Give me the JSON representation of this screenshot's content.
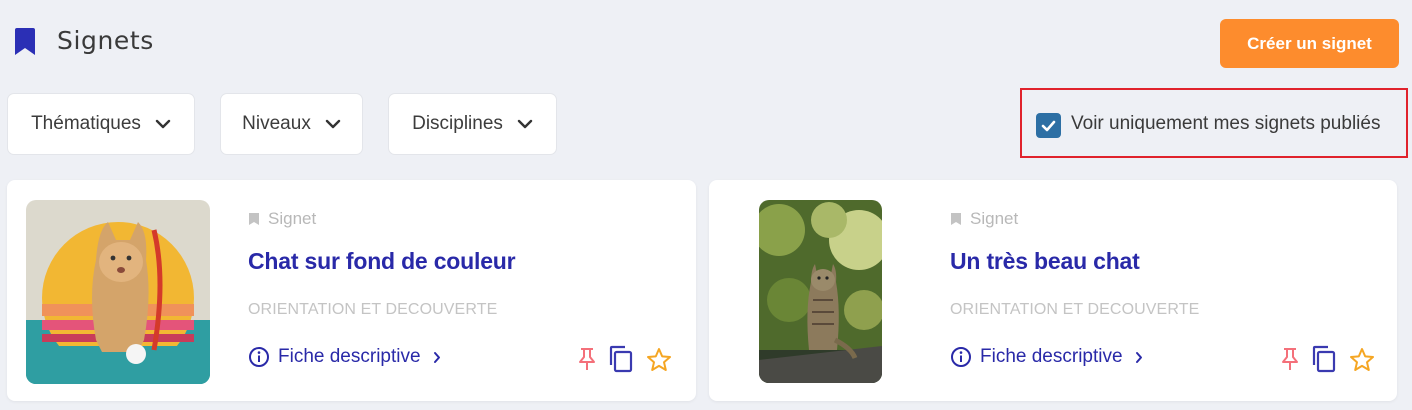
{
  "header": {
    "title": "Signets",
    "create_button_label": "Créer un signet"
  },
  "filters": [
    {
      "label": "Thématiques"
    },
    {
      "label": "Niveaux"
    },
    {
      "label": "Disciplines"
    }
  ],
  "published_only": {
    "label": "Voir uniquement mes signets publiés",
    "checked": true
  },
  "cards": [
    {
      "type_label": "Signet",
      "title": "Chat sur fond de couleur",
      "category": "ORIENTATION ET DECOUVERTE",
      "link_label": "Fiche descriptive"
    },
    {
      "type_label": "Signet",
      "title": "Un très beau chat",
      "category": "ORIENTATION ET DECOUVERTE",
      "link_label": "Fiche descriptive"
    }
  ],
  "icons": {
    "header": "bookmark-icon",
    "filter_toggle": "chevron-down-icon",
    "card_type": "bookmark-icon",
    "card_link": "info-icon",
    "card_actions": [
      "pin-icon",
      "copy-icon",
      "star-icon"
    ]
  },
  "colors": {
    "background": "#eef0f5",
    "accent_orange": "#fd8c2d",
    "title_blue": "#2929a8",
    "checkbox_blue": "#2d6fa4",
    "pin_red": "#f4707a",
    "star_orange": "#f5a623",
    "highlight_red": "#e0222c"
  }
}
